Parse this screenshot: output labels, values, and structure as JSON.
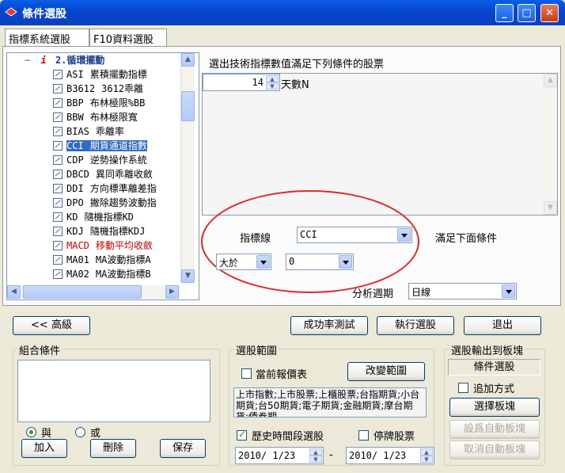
{
  "window": {
    "title": "條件選股",
    "minimize": "_",
    "maximize": "□",
    "close": "✕"
  },
  "tabs": [
    "指標系統選股",
    "F10資料選股"
  ],
  "tree": {
    "group": "2.循環擺動",
    "group_marker": "i",
    "expander": "−",
    "items": [
      {
        "code": "ASI",
        "name": "累積擺動指標"
      },
      {
        "code": "B3612",
        "name": "3612乖離"
      },
      {
        "code": "BBP",
        "name": "布林極限%BB"
      },
      {
        "code": "BBW",
        "name": "布林極限寬"
      },
      {
        "code": "BIAS",
        "name": "乖離率"
      },
      {
        "code": "CCI",
        "name": "期貨通道指數"
      },
      {
        "code": "CDP",
        "name": "逆勢操作系統"
      },
      {
        "code": "DBCD",
        "name": "異同乖離收斂"
      },
      {
        "code": "DDI",
        "name": "方向標準離差指"
      },
      {
        "code": "DPO",
        "name": "撇除趨勢波動指"
      },
      {
        "code": "KD",
        "name": "隨機指標KD"
      },
      {
        "code": "KDJ",
        "name": "隨機指標KDJ"
      },
      {
        "code": "MACD",
        "name": "移動平均收斂"
      },
      {
        "code": "MA01",
        "name": "MA波動指標A"
      },
      {
        "code": "MA02",
        "name": "MA波動指標B"
      }
    ],
    "selected": "CCI",
    "highlighted_red": "MACD"
  },
  "panel": {
    "description": "選出技術指標數值滿足下列條件的股票",
    "param": {
      "value": "14",
      "label": "天數N"
    },
    "indicator_label": "指標線",
    "indicator_value": "CCI",
    "condition_suffix": "滿足下面條件",
    "operator": "大於",
    "threshold": "0",
    "period_label": "分析週期",
    "period_value": "日線"
  },
  "buttons": {
    "advanced": "<< 高級",
    "success_test": "成功率測試",
    "execute": "執行選股",
    "exit": "退出"
  },
  "combo_group": {
    "title": "組合條件",
    "and": "與",
    "or": "或",
    "add": "加入",
    "delete": "刪除",
    "save": "保存"
  },
  "range_group": {
    "title": "選股範圍",
    "current_quote": "當前報價表",
    "change_range": "改變範圍",
    "range_text": "上市指數;上市股票;上櫃股票;台指期貨;小台期貨;台50期貨;電子期貨;金融期貨;摩台期貨;債券期",
    "history": "歷史時間段選股",
    "suspended": "停牌股票",
    "date_from": "2010/ 1/23",
    "dash": "-",
    "date_to": "2010/ 1/23"
  },
  "output_group": {
    "title": "選股輸出到板塊",
    "target": "條件選股",
    "append": "追加方式",
    "choose_block": "選擇板塊",
    "set_auto": "設爲自動板塊",
    "cancel_auto": "取消自動板塊"
  },
  "colors": {
    "titlebar": "#0546d0",
    "selection": "#316ac5",
    "highlight_oval": "#e02828"
  }
}
